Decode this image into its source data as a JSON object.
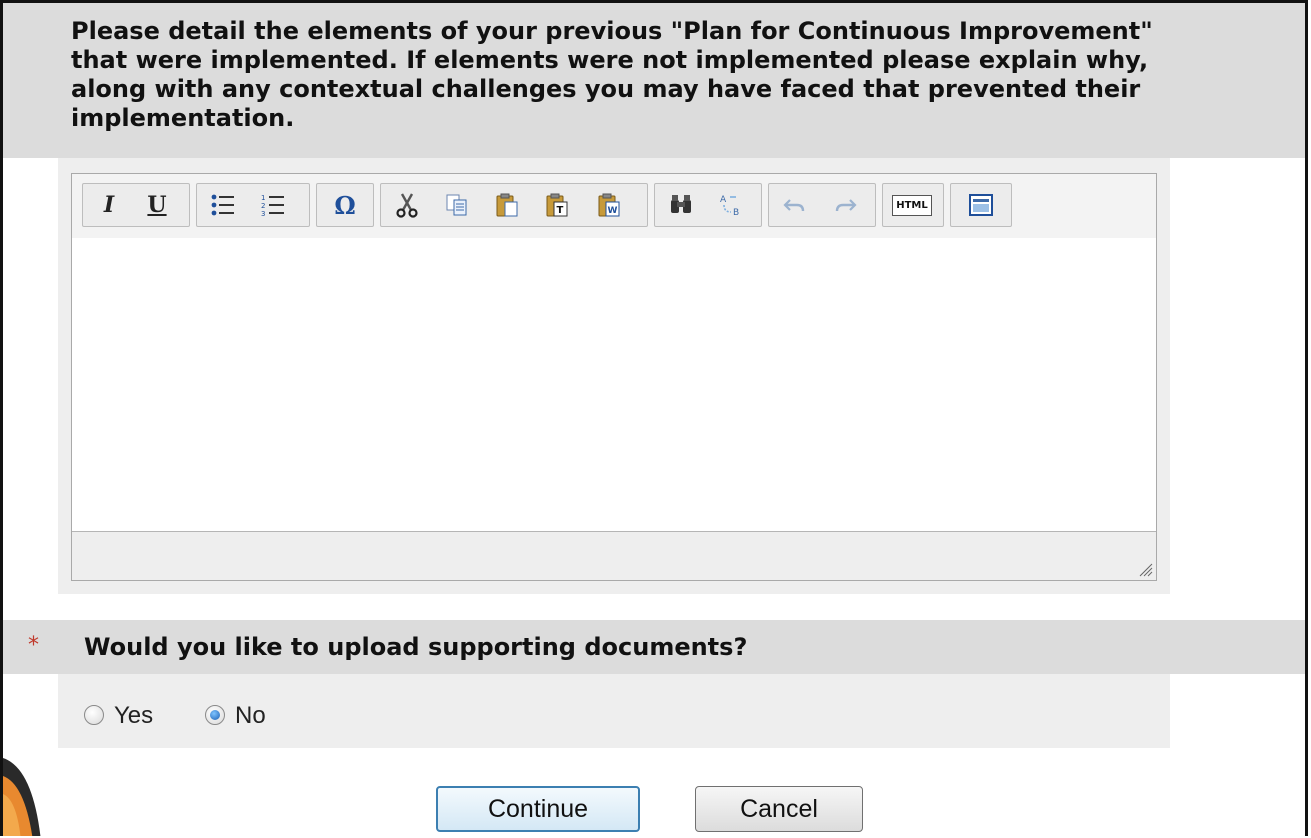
{
  "question1": {
    "text": "Please detail the elements of your previous \"Plan for Continuous Improvement\" that were implemented. If elements were not implemented please explain why, along with any contextual challenges you may have faced that prevented their implementation."
  },
  "editor": {
    "toolbar": {
      "italic": "I",
      "underline": "U",
      "special_char": "Ω",
      "html": "HTML"
    },
    "content": ""
  },
  "question2": {
    "required_mark": "*",
    "text": "Would you like to upload supporting documents?",
    "options": [
      "Yes",
      "No"
    ],
    "selected": "No"
  },
  "buttons": {
    "continue": "Continue",
    "cancel": "Cancel"
  },
  "colors": {
    "header_bg": "#dcdcdc",
    "body_bg": "#eeeeee",
    "required": "#c0392b",
    "primary_border": "#3c7fb1"
  }
}
